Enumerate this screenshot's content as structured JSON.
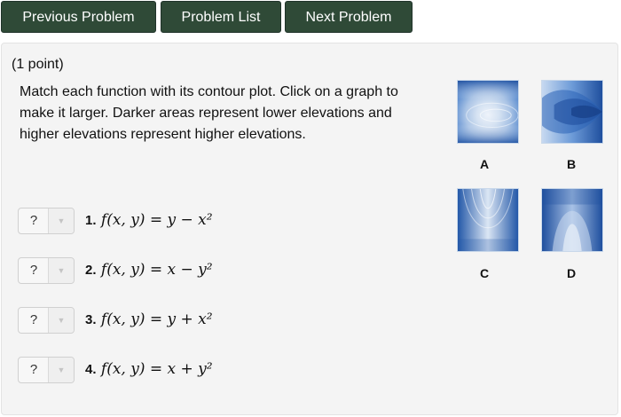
{
  "nav": {
    "previous_label": "Previous Problem",
    "list_label": "Problem List",
    "next_label": "Next Problem"
  },
  "problem": {
    "points": "(1 point)",
    "prompt": "Match each function with its contour plot. Click on a graph to make it larger. Darker areas represent lower elevations and higher elevations represent higher elevations."
  },
  "graphs": [
    {
      "label": "A",
      "icon": "contour-plot-a-icon"
    },
    {
      "label": "B",
      "icon": "contour-plot-b-icon"
    },
    {
      "label": "C",
      "icon": "contour-plot-c-icon"
    },
    {
      "label": "D",
      "icon": "contour-plot-d-icon"
    }
  ],
  "questions": [
    {
      "selected": "?",
      "number": "1.",
      "function": "f(x, y) = y − x²"
    },
    {
      "selected": "?",
      "number": "2.",
      "function": "f(x, y) = x − y²"
    },
    {
      "selected": "?",
      "number": "3.",
      "function": "f(x, y) = y + x²"
    },
    {
      "selected": "?",
      "number": "4.",
      "function": "f(x, y) = x + y²"
    }
  ],
  "colors": {
    "nav_button": "#2f4a37",
    "contour_dark": "#2358a8",
    "contour_light": "#e6eef8"
  }
}
